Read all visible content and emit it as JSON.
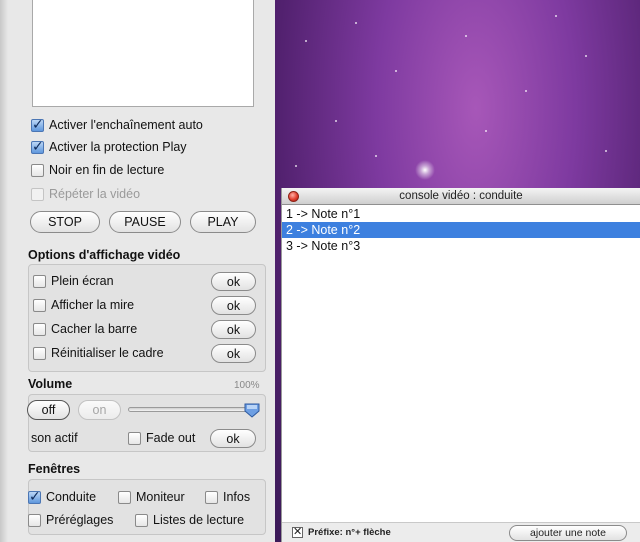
{
  "playback": {
    "options": [
      {
        "label": "Activer l'enchaînement auto",
        "checked": true,
        "disabled": false
      },
      {
        "label": "Activer la protection Play",
        "checked": true,
        "disabled": false
      },
      {
        "label": "Noir en fin de lecture",
        "checked": false,
        "disabled": false
      },
      {
        "label": "Répéter la vidéo",
        "checked": false,
        "disabled": true
      }
    ],
    "buttons": {
      "stop": "STOP",
      "pause": "PAUSE",
      "play": "PLAY"
    }
  },
  "video_display": {
    "title": "Options d'affichage vidéo",
    "options": [
      {
        "label": "Plein écran",
        "ok": "ok"
      },
      {
        "label": "Afficher la mire",
        "ok": "ok"
      },
      {
        "label": "Cacher la barre",
        "ok": "ok"
      },
      {
        "label": "Réinitialiser le cadre",
        "ok": "ok"
      }
    ]
  },
  "volume": {
    "title": "Volume",
    "percent": "100%",
    "level": 1.0,
    "off_label": "off",
    "on_label": "on",
    "status": "son actif",
    "fade_label": "Fade out",
    "fade_ok": "ok"
  },
  "windows": {
    "title": "Fenêtres",
    "row1": [
      {
        "label": "Conduite",
        "checked": true
      },
      {
        "label": "Moniteur",
        "checked": false
      },
      {
        "label": "Infos",
        "checked": false
      }
    ],
    "row2": [
      {
        "label": "Préréglages",
        "checked": false
      },
      {
        "label": "Listes de lecture",
        "checked": false
      }
    ]
  },
  "console": {
    "title": "console vidéo : conduite",
    "notes": [
      "1 -> Note n°1",
      "2 -> Note n°2",
      "3 -> Note n°3"
    ],
    "selected_index": 1,
    "prefix_label": "Préfixe: n°+ flèche",
    "prefix_checked": true,
    "add_note": "ajouter une note"
  },
  "colors": {
    "selection": "#3d80df",
    "desktop": "#7e3aa0",
    "checkbox_accent": "#5f97dd"
  }
}
